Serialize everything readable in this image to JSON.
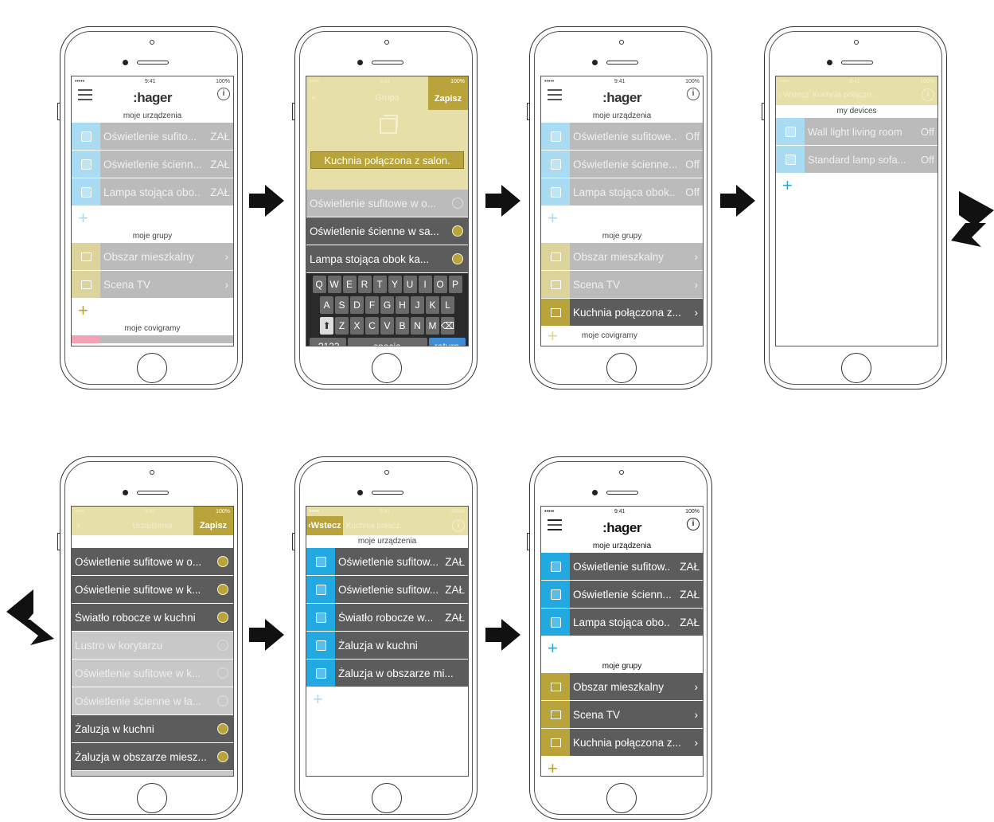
{
  "status": {
    "signal": "•••••",
    "time": "9:41",
    "battery": "100%"
  },
  "logo": "hager",
  "info": "i",
  "plus": "+",
  "chevron": "›",
  "radio_on": "on",
  "radio_off": "off",
  "screen1": {
    "sec_devices": "moje urządzenia",
    "devices": [
      {
        "name": "Oświetlenie sufito...",
        "state": "ZAŁ"
      },
      {
        "name": "Oświetlenie ścienn...",
        "state": "ZAŁ"
      },
      {
        "name": "Lampa stojąca obo..",
        "state": "ZAŁ"
      }
    ],
    "sec_groups": "moje grupy",
    "groups": [
      "Obszar mieszkalny",
      "Scena TV"
    ],
    "sec_covigrams": "moje covigramy"
  },
  "screen2": {
    "cancel": "×",
    "title": "Grupa",
    "save": "Zapisz",
    "group_name": "Kuchnia połączona z salon.",
    "items": [
      {
        "name": "Oświetlenie sufitowe w o...",
        "selected": "off"
      },
      {
        "name": "Oświetlenie ścienne w sa...",
        "selected": "on"
      },
      {
        "name": "Lampa stojąca obok ka...",
        "selected": "on"
      }
    ],
    "keyboard": {
      "row1": [
        "Q",
        "W",
        "E",
        "R",
        "T",
        "Y",
        "U",
        "I",
        "O",
        "P"
      ],
      "row2": [
        "A",
        "S",
        "D",
        "F",
        "G",
        "H",
        "J",
        "K",
        "L"
      ],
      "row3": [
        "Z",
        "X",
        "C",
        "V",
        "B",
        "N",
        "M"
      ],
      "shift": "⬆",
      "backspace": "⌫",
      "numbers": ".?123",
      "space": "spacja",
      "return": "return"
    }
  },
  "screen3": {
    "sec_devices": "moje urządzenia",
    "devices": [
      {
        "name": "Oświetlenie sufitowe..",
        "state": "Off"
      },
      {
        "name": "Oświetlenie ścienne...",
        "state": "Off"
      },
      {
        "name": "Lampa stojąca obok..",
        "state": "Off"
      }
    ],
    "sec_groups": "moje grupy",
    "groups": [
      "Obszar mieszkalny",
      "Scena TV",
      "Kuchnia połączona z..."
    ],
    "sec_covigrams": "moje covigramy"
  },
  "screen4": {
    "back": "‹ Wstecz",
    "title": "Kuchnia połączo...",
    "sec_devices": "my devices",
    "devices": [
      {
        "name": "Wall light living room",
        "state": "Off"
      },
      {
        "name": "Standard lamp sofa...",
        "state": "Off"
      }
    ]
  },
  "screen5": {
    "cancel": "×",
    "title": "Urządzenia",
    "save": "Zapisz",
    "items": [
      {
        "name": "Oświetlenie sufitowe w o...",
        "selected": "on"
      },
      {
        "name": "Oświetlenie sufitowe w k...",
        "selected": "on"
      },
      {
        "name": "Światło robocze w kuchni",
        "selected": "on"
      },
      {
        "name": "Lustro w korytarzu",
        "selected": "off"
      },
      {
        "name": "Oświetlenie sufitowe w k...",
        "selected": "off"
      },
      {
        "name": "Oświetlenie ścienne w ła...",
        "selected": "off"
      },
      {
        "name": "Żaluzja w kuchni",
        "selected": "on"
      },
      {
        "name": "Żaluzja w obszarze miesz...",
        "selected": "on"
      },
      {
        "name": "",
        "selected": "off"
      }
    ]
  },
  "screen6": {
    "back": "‹Wstecz",
    "title": "Kuchnia połącz..",
    "sec_devices": "moje urządzenia",
    "devices": [
      {
        "name": "Oświetlenie sufitow...",
        "state": "ZAŁ"
      },
      {
        "name": "Oświetlenie sufitow...",
        "state": "ZAŁ"
      },
      {
        "name": "Światło robocze w...",
        "state": "ZAŁ"
      },
      {
        "name": "Żaluzja w kuchni",
        "state": ""
      },
      {
        "name": "Żaluzja w obszarze mi...",
        "state": ""
      }
    ]
  },
  "screen7": {
    "sec_devices": "moje urządzenia",
    "devices": [
      {
        "name": "Oświetlenie sufitow..",
        "state": "ZAŁ"
      },
      {
        "name": "Oświetlenie ścienn...",
        "state": "ZAŁ"
      },
      {
        "name": "Lampa stojąca obo..",
        "state": "ZAŁ"
      }
    ],
    "sec_groups": "moje grupy",
    "groups": [
      "Obszar mieszkalny",
      "Scena TV",
      "Kuchnia połączona z..."
    ]
  }
}
